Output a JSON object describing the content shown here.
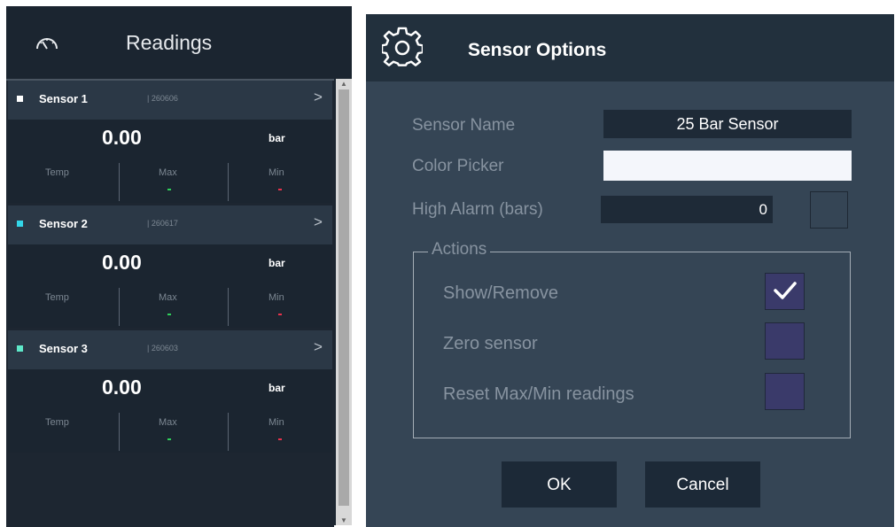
{
  "readings": {
    "title": "Readings",
    "sensors": [
      {
        "name": "Sensor 1",
        "serial": "| 260606",
        "value": "0.00",
        "unit": "bar",
        "temp_label": "Temp",
        "max_label": "Max",
        "min_label": "Min",
        "chevron": ">",
        "color": "#ffffff"
      },
      {
        "name": "Sensor 2",
        "serial": "| 260617",
        "value": "0.00",
        "unit": "bar",
        "temp_label": "Temp",
        "max_label": "Max",
        "min_label": "Min",
        "chevron": ">",
        "color": "#33d6e8"
      },
      {
        "name": "Sensor 3",
        "serial": "| 260603",
        "value": "0.00",
        "unit": "bar",
        "temp_label": "Temp",
        "max_label": "Max",
        "min_label": "Min",
        "chevron": ">",
        "color": "#5ee8c9"
      }
    ]
  },
  "dialog": {
    "title": "Sensor Options",
    "sensor_name_label": "Sensor Name",
    "sensor_name_value": "25 Bar Sensor",
    "color_picker_label": "Color Picker",
    "color_picker_value": "#f4f6fb",
    "high_alarm_label": "High Alarm (bars)",
    "high_alarm_value": "0",
    "actions_legend": "Actions",
    "actions": [
      {
        "label": "Show/Remove",
        "checked": true
      },
      {
        "label": "Zero sensor",
        "checked": false
      },
      {
        "label": "Reset Max/Min readings",
        "checked": false
      }
    ],
    "ok_label": "OK",
    "cancel_label": "Cancel"
  },
  "colors": {
    "max_marker": "#2fd05a",
    "min_marker": "#e8324b",
    "checkbox_fill": "#3a3a6a"
  }
}
